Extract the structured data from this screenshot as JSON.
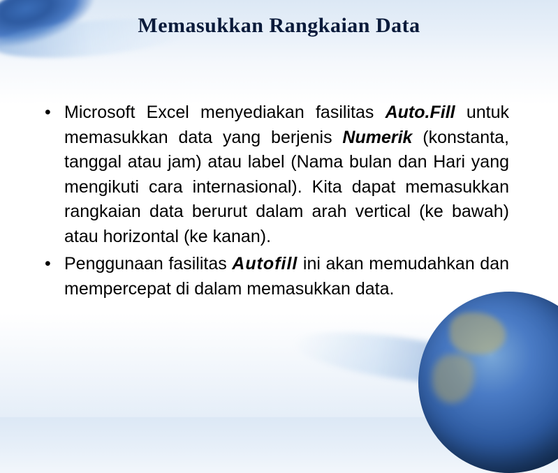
{
  "title": "Memasukkan Rangkaian Data",
  "bullets": [
    {
      "p1": "Microsoft Excel menyediakan fasilitas ",
      "em1": "Auto.Fill",
      "p2": " untuk memasukkan data yang berjenis ",
      "em2": "Numerik",
      "p3": " (konstanta, tanggal atau jam) atau label (Nama bulan dan Hari yang mengikuti cara internasional). Kita dapat memasukkan rangkaian data berurut dalam arah vertical (ke bawah) atau horizontal (ke kanan)."
    },
    {
      "p1": "Penggunaan fasilitas ",
      "em1": "Autofill",
      "p2": " ini akan memudahkan dan mempercepat di dalam memasukkan data."
    }
  ]
}
